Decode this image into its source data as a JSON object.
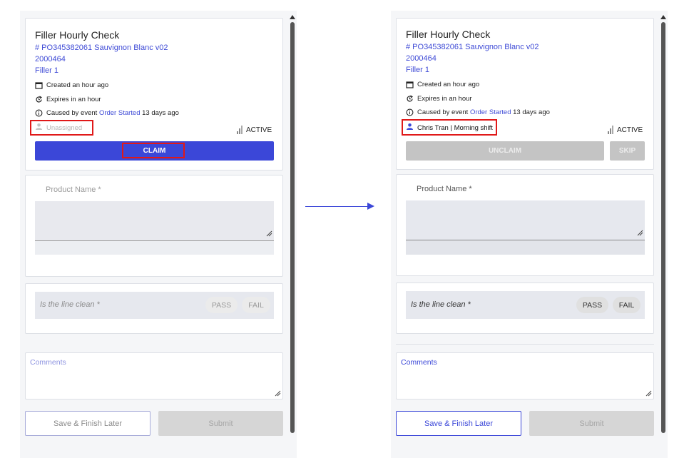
{
  "before": {
    "title": "Filler Hourly Check",
    "order": "# PO345382061 Sauvignon Blanc v02",
    "code": "2000464",
    "line": "Filler 1",
    "created": "Created an hour ago",
    "expires": "Expires in an hour",
    "caused_prefix": "Caused by event",
    "caused_event": "Order Started",
    "caused_suffix": "13 days ago",
    "assignee": "Unassigned",
    "status": "ACTIVE",
    "claim_label": "CLAIM",
    "product_name_label": "Product Name *",
    "question": "Is the line clean *",
    "pass_label": "PASS",
    "fail_label": "FAIL",
    "comments_label": "Comments",
    "save_label": "Save & Finish Later",
    "submit_label": "Submit"
  },
  "after": {
    "title": "Filler Hourly Check",
    "order": "# PO345382061 Sauvignon Blanc v02",
    "code": "2000464",
    "line": "Filler 1",
    "created": "Created an hour ago",
    "expires": "Expires in an hour",
    "caused_prefix": "Caused by event",
    "caused_event": "Order Started",
    "caused_suffix": "13 days ago",
    "assignee": "Chris Tran | Morning shift",
    "status": "ACTIVE",
    "unclaim_label": "UNCLAIM",
    "skip_label": "SKIP",
    "product_name_label": "Product Name *",
    "question": "Is the line clean *",
    "pass_label": "PASS",
    "fail_label": "FAIL",
    "comments_label": "Comments",
    "save_label": "Save & Finish Later",
    "submit_label": "Submit"
  },
  "colors": {
    "accent": "#3b47d8",
    "highlight": "#e01919",
    "link": "#3f4bd6"
  },
  "icons": [
    "calendar-icon",
    "refresh-clock-icon",
    "info-icon",
    "person-icon",
    "signal-icon",
    "resize-handle-icon",
    "arrow-right-icon"
  ]
}
